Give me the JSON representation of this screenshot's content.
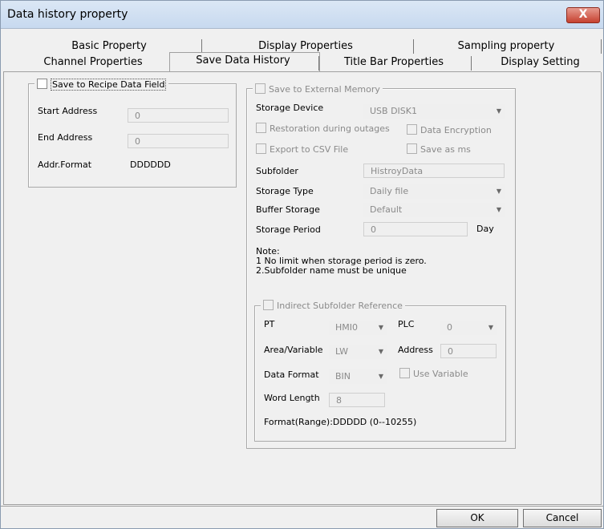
{
  "window": {
    "title": "Data history property",
    "close_glyph": "X"
  },
  "tabs": {
    "row1": [
      "Basic Property",
      "Display Properties",
      "Sampling property"
    ],
    "row2": [
      "Channel Properties",
      "Save Data History",
      "Title Bar Properties",
      "Display Setting"
    ]
  },
  "recipe": {
    "label": "Save to Recipe Data Field",
    "start_address_label": "Start Address",
    "start_address_value": "0",
    "end_address_label": "End Address",
    "end_address_value": "0",
    "addr_format_label": "Addr.Format",
    "addr_format_value": "DDDDDD"
  },
  "external": {
    "label": "Save to External Memory",
    "storage_device_label": "Storage Device",
    "storage_device_value": "USB DISK1",
    "restoration_label": "Restoration during outages",
    "encryption_label": "Data Encryption",
    "export_csv_label": "Export to CSV File",
    "save_ms_label": "Save as ms",
    "subfolder_label": "Subfolder",
    "subfolder_value": "HistroyData",
    "storage_type_label": "Storage Type",
    "storage_type_value": "Daily file",
    "buffer_storage_label": "Buffer Storage",
    "buffer_storage_value": "Default",
    "storage_period_label": "Storage Period",
    "storage_period_value": "0",
    "storage_period_unit": "Day",
    "note_title": "Note:",
    "note_1": "1 No limit when storage period is zero.",
    "note_2": "2.Subfolder name must be unique"
  },
  "indirect": {
    "label": "Indirect Subfolder Reference",
    "pt_label": "PT",
    "pt_value": "HMI0",
    "plc_label": "PLC",
    "plc_value": "0",
    "area_label": "Area/Variable",
    "area_value": "LW",
    "address_label": "Address",
    "address_value": "0",
    "data_format_label": "Data Format",
    "data_format_value": "BIN",
    "use_variable_label": "Use Variable",
    "word_length_label": "Word Length",
    "word_length_value": "8",
    "format_range": "Format(Range):DDDDD (0--10255)"
  },
  "buttons": {
    "ok": "OK",
    "cancel": "Cancel"
  },
  "icons": {
    "dropdown": "▼"
  }
}
